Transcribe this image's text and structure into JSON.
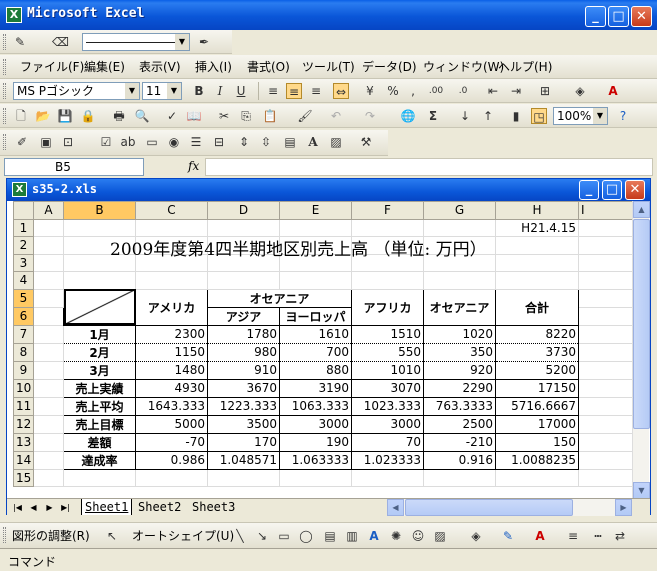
{
  "app": {
    "title": "Microsoft Excel",
    "icon_name": "excel-icon"
  },
  "drawing_toolbar_top": {
    "line_style": "――――――――"
  },
  "menu": [
    "ファイル(F)",
    "編集(E)",
    "表示(V)",
    "挿入(I)",
    "書式(O)",
    "ツール(T)",
    "データ(D)",
    "ウィンドウ(W)",
    "ヘルプ(H)"
  ],
  "format": {
    "font": "MS Pゴシック",
    "size": "11",
    "bold": "B",
    "italic": "I",
    "underline": "U",
    "currency": "%",
    "comma": ",",
    "font_color_label": "A"
  },
  "standard": {
    "zoom": "100%"
  },
  "formula": {
    "name_box": "B5",
    "fx": "fx",
    "value": ""
  },
  "workbook": {
    "title": "s35-2.xls"
  },
  "columns": [
    "A",
    "B",
    "C",
    "D",
    "E",
    "F",
    "G",
    "H",
    "I"
  ],
  "rows": [
    "1",
    "2",
    "3",
    "4",
    "5",
    "6",
    "7",
    "8",
    "9",
    "10",
    "11",
    "12",
    "13",
    "14",
    "15"
  ],
  "sheet": {
    "date": "H21.4.15",
    "title": "2009年度第4四半期地区別売上高 （単位: 万円）",
    "hdr_america": "アメリカ",
    "hdr_oceania_group": "オセアニア",
    "hdr_asia": "アジア",
    "hdr_europe": "ヨーロッパ",
    "hdr_africa": "アフリカ",
    "hdr_oceania": "オセアニア",
    "hdr_total": "合計",
    "data_rows": [
      {
        "label": "1月",
        "values": [
          "2300",
          "1780",
          "1610",
          "1510",
          "1020",
          "8220"
        ]
      },
      {
        "label": "2月",
        "values": [
          "1150",
          "980",
          "700",
          "550",
          "350",
          "3730"
        ]
      },
      {
        "label": "3月",
        "values": [
          "1480",
          "910",
          "880",
          "1010",
          "920",
          "5200"
        ]
      },
      {
        "label": "売上実績",
        "values": [
          "4930",
          "3670",
          "3190",
          "3070",
          "2290",
          "17150"
        ]
      },
      {
        "label": "売上平均",
        "values": [
          "1643.333",
          "1223.333",
          "1063.333",
          "1023.333",
          "763.3333",
          "5716.6667"
        ]
      },
      {
        "label": "売上目標",
        "values": [
          "5000",
          "3500",
          "3000",
          "3000",
          "2500",
          "17000"
        ]
      },
      {
        "label": "差額",
        "values": [
          "-70",
          "170",
          "190",
          "70",
          "-210",
          "150"
        ]
      },
      {
        "label": "達成率",
        "values": [
          "0.986",
          "1.048571",
          "1.063333",
          "1.023333",
          "0.916",
          "1.0088235"
        ]
      }
    ]
  },
  "sheet_tabs": [
    "Sheet1",
    "Sheet2",
    "Sheet3"
  ],
  "drawbar": {
    "shape_adjust": "図形の調整(R)",
    "autoshape": "オートシェイプ(U)"
  },
  "status": {
    "text": "コマンド"
  }
}
